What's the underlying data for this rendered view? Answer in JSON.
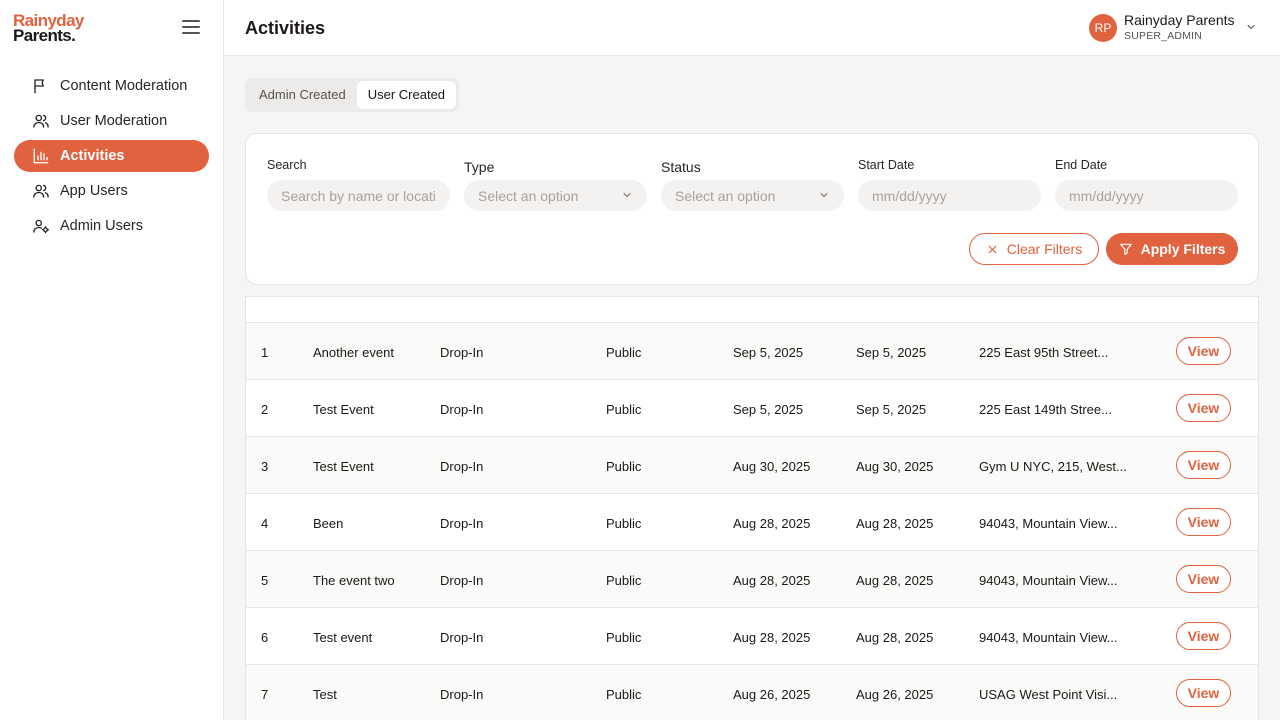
{
  "brand": {
    "line1": "Rainyday",
    "line2": "Parents."
  },
  "nav": [
    {
      "label": "Content Moderation",
      "icon": "flag-icon",
      "active": false
    },
    {
      "label": "User Moderation",
      "icon": "users-icon",
      "active": false
    },
    {
      "label": "Activities",
      "icon": "bar-chart-icon",
      "active": true
    },
    {
      "label": "App Users",
      "icon": "users-icon",
      "active": false
    },
    {
      "label": "Admin Users",
      "icon": "user-cog-icon",
      "active": false
    }
  ],
  "header": {
    "title": "Activities",
    "user": {
      "initials": "RP",
      "name": "Rainyday Parents",
      "role": "SUPER_ADMIN"
    }
  },
  "tabs": [
    {
      "label": "Admin Created",
      "active": false
    },
    {
      "label": "User Created",
      "active": true
    }
  ],
  "filters": {
    "search": {
      "label": "Search",
      "placeholder": "Search by name or location"
    },
    "type": {
      "label": "Type",
      "placeholder": "Select an option"
    },
    "status": {
      "label": "Status",
      "placeholder": "Select an option"
    },
    "start_date": {
      "label": "Start Date",
      "placeholder": "mm/dd/yyyy"
    },
    "end_date": {
      "label": "End Date",
      "placeholder": "mm/dd/yyyy"
    },
    "clear_label": "Clear Filters",
    "apply_label": "Apply Filters"
  },
  "table": {
    "view_label": "View",
    "rows": [
      {
        "idx": "1",
        "name": "Another event",
        "type": "Drop-In",
        "visibility": "Public",
        "start": "Sep 5, 2025",
        "end": "Sep 5, 2025",
        "location": "225 East 95th Street..."
      },
      {
        "idx": "2",
        "name": "Test Event",
        "type": "Drop-In",
        "visibility": "Public",
        "start": "Sep 5, 2025",
        "end": "Sep 5, 2025",
        "location": "225 East 149th Stree..."
      },
      {
        "idx": "3",
        "name": "Test Event",
        "type": "Drop-In",
        "visibility": "Public",
        "start": "Aug 30, 2025",
        "end": "Aug 30, 2025",
        "location": "Gym U NYC, 215, West..."
      },
      {
        "idx": "4",
        "name": "Been",
        "type": "Drop-In",
        "visibility": "Public",
        "start": "Aug 28, 2025",
        "end": "Aug 28, 2025",
        "location": "94043, Mountain View..."
      },
      {
        "idx": "5",
        "name": "The event two",
        "type": "Drop-In",
        "visibility": "Public",
        "start": "Aug 28, 2025",
        "end": "Aug 28, 2025",
        "location": "94043, Mountain View..."
      },
      {
        "idx": "6",
        "name": "Test event",
        "type": "Drop-In",
        "visibility": "Public",
        "start": "Aug 28, 2025",
        "end": "Aug 28, 2025",
        "location": "94043, Mountain View..."
      },
      {
        "idx": "7",
        "name": "Test",
        "type": "Drop-In",
        "visibility": "Public",
        "start": "Aug 26, 2025",
        "end": "Aug 26, 2025",
        "location": "USAG West Point Visi..."
      }
    ]
  },
  "colors": {
    "accent": "#e0623e",
    "text": "#1c1917",
    "muted": "#57534e",
    "border": "#e7e5e4"
  }
}
